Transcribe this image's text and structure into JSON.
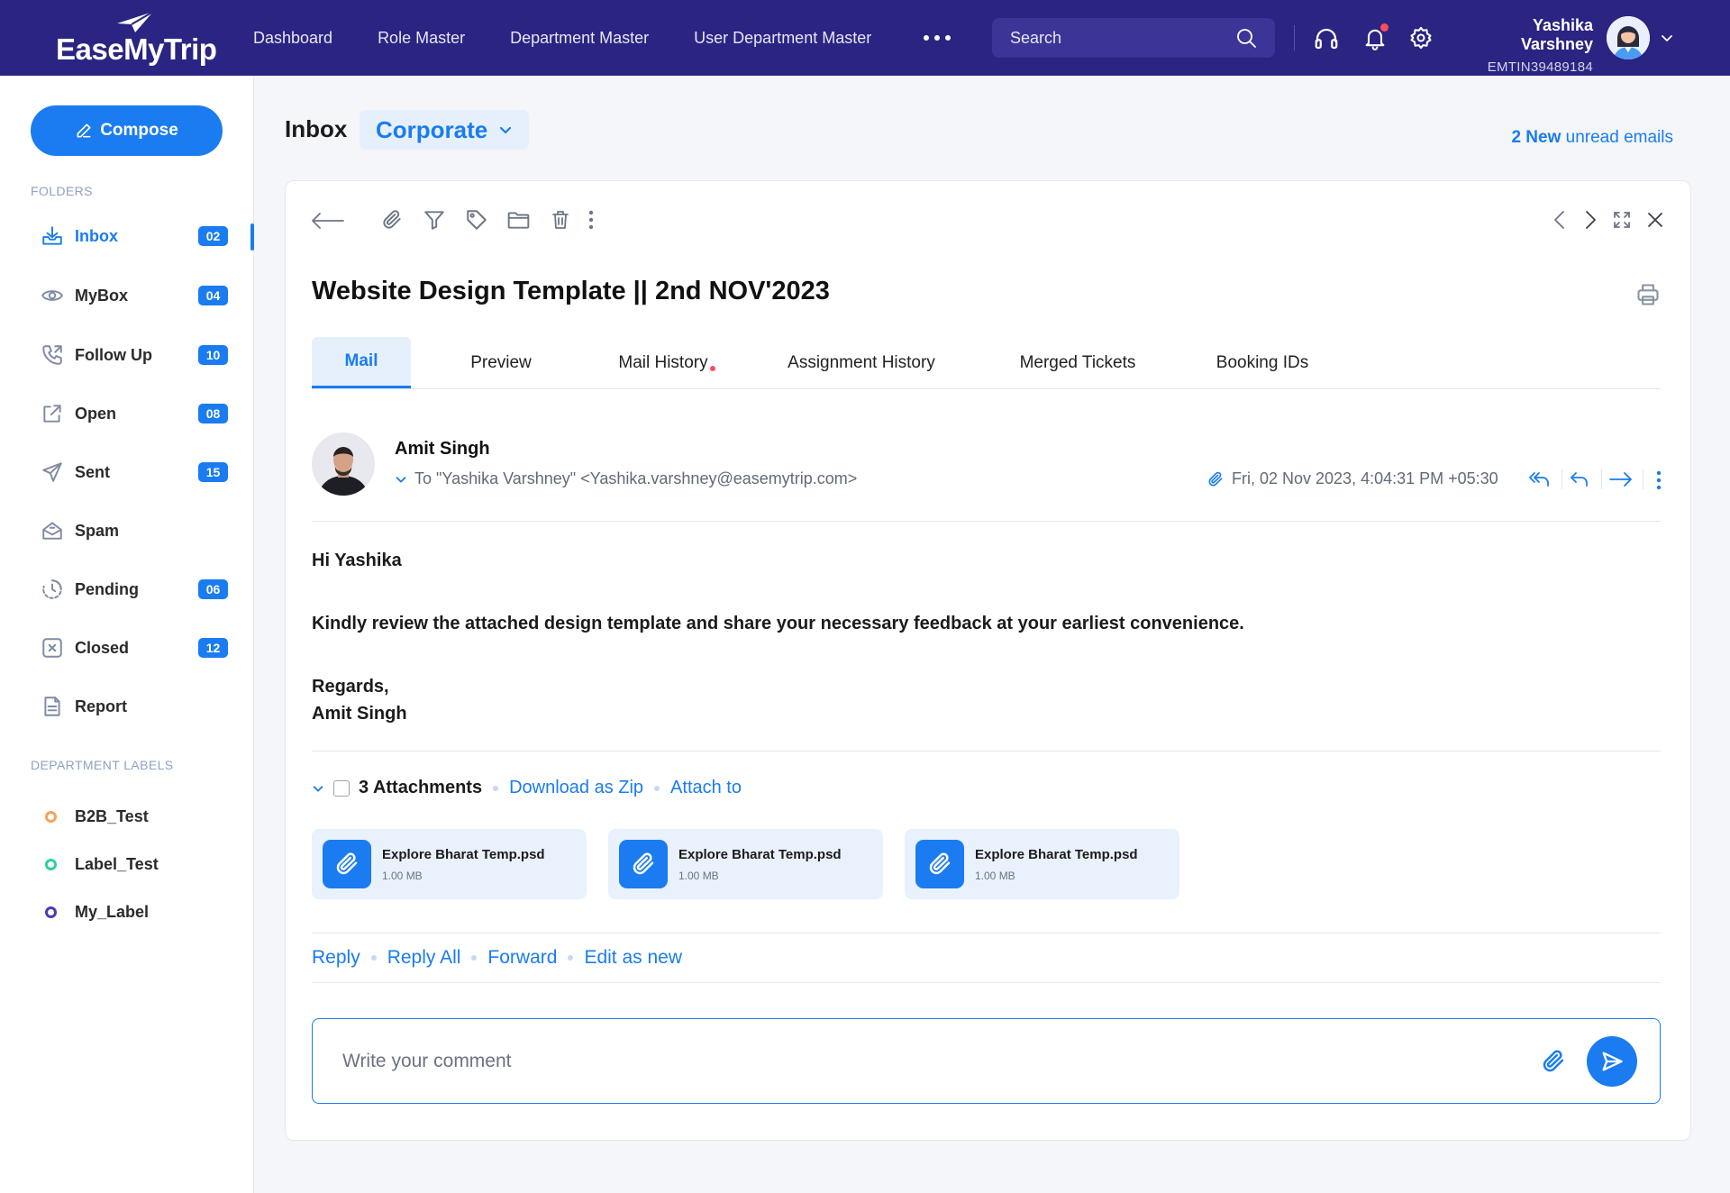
{
  "app": {
    "logo_text": "EaseMyTrip"
  },
  "topnav": {
    "items": [
      "Dashboard",
      "Role Master",
      "Department Master",
      "User Department Master"
    ],
    "search_placeholder": "Search",
    "user_name": "Yashika Varshney",
    "user_id": "EMTIN39489184"
  },
  "sidebar": {
    "compose_label": "Compose",
    "folders_heading": "FOLDERS",
    "folders": [
      {
        "label": "Inbox",
        "count": "02",
        "icon": "inbox-icon"
      },
      {
        "label": "MyBox",
        "count": "04",
        "icon": "eye-icon"
      },
      {
        "label": "Follow Up",
        "count": "10",
        "icon": "phone-icon"
      },
      {
        "label": "Open",
        "count": "08",
        "icon": "external-link-icon"
      },
      {
        "label": "Sent",
        "count": "15",
        "icon": "send-icon"
      },
      {
        "label": "Spam",
        "count": "",
        "icon": "spam-icon"
      },
      {
        "label": "Pending",
        "count": "06",
        "icon": "clock-icon"
      },
      {
        "label": "Closed",
        "count": "12",
        "icon": "close-box-icon"
      },
      {
        "label": "Report",
        "count": "",
        "icon": "report-icon"
      }
    ],
    "labels_heading": "DEPARTMENT LABELS",
    "labels": [
      {
        "label": "B2B_Test",
        "color": "#f5a25d"
      },
      {
        "label": "Label_Test",
        "color": "#2fd0a0"
      },
      {
        "label": "My_Label",
        "color": "#4a3cb0"
      }
    ]
  },
  "main": {
    "title": "Inbox",
    "mailbox": "Corporate",
    "unread_count": "2 New",
    "unread_suffix": "unread emails"
  },
  "mail": {
    "subject": "Website Design Template || 2nd NOV'2023",
    "tabs": [
      "Mail",
      "Preview",
      "Mail History",
      "Assignment History",
      "Merged Tickets",
      "Booking IDs"
    ],
    "sender": "Amit Singh",
    "recipient": "To \"Yashika Varshney\" <Yashika.varshney@easemytrip.com>",
    "date": "Fri, 02 Nov 2023, 4:04:31 PM +05:30",
    "greeting": "Hi Yashika",
    "body": "Kindly review the attached design template and share your necessary feedback at your earliest convenience.",
    "signoff": "Regards,",
    "signature": "Amit Singh",
    "attachments_label": "3 Attachments",
    "download_zip": "Download as Zip",
    "attach_to": "Attach to",
    "attachments": [
      {
        "name": "Explore Bharat Temp.psd",
        "size": "1.00 MB"
      },
      {
        "name": "Explore Bharat Temp.psd",
        "size": "1.00 MB"
      },
      {
        "name": "Explore Bharat Temp.psd",
        "size": "1.00 MB"
      }
    ],
    "actions": [
      "Reply",
      "Reply All",
      "Forward",
      "Edit as new"
    ],
    "comment_placeholder": "Write your comment"
  },
  "colors": {
    "brand": "#2a2482",
    "accent": "#1a7cf0"
  }
}
